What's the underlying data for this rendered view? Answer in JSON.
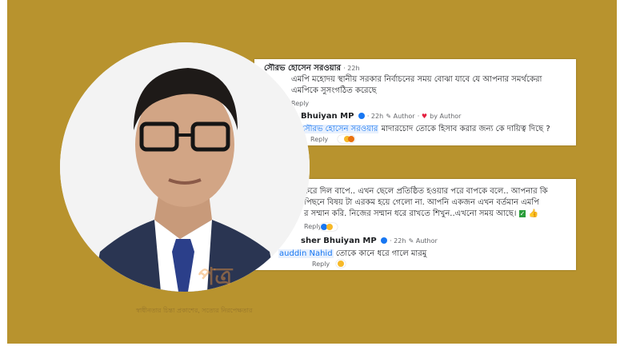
{
  "comments": {
    "c1": {
      "author": "সৌরভ হোসেন সরওয়ার",
      "time": "22h",
      "text_line1": "এমপি মহোদয় স্থানীয় সরকার নির্বাচনের সময় বোঝা যাবে যে আপনার সমর্থকেরা",
      "text_line2": "এমপিকে সুসংগঠিত করেছে",
      "reply_label": "Reply"
    },
    "r1": {
      "author": "Bhuiyan MP",
      "time": "22h",
      "author_tag": "Author",
      "liked_by": "Author",
      "mention": "সৌরভ হোসেন সরওয়ার",
      "text": "মাদারচোদ তোকে হিসাব করার জন্য কে দায়িত্ব দিছে ?",
      "reply_label": "Reply"
    },
    "c2": {
      "text_line1": "করে দিল বাপে.. এখন ছেলে প্রতিষ্ঠিত হওয়ার পরে বাপকে বলে.. আপনার কি",
      "text_line2": "পিছনে বিষয় টা এরকম হয়ে গেলো না. আপনি একজন এখন বর্তমান এমপি",
      "text_line3": "র সম্মান করি. নিজের সম্মান ধরে রাখতে শিখুন..এখনো সময় আছে।",
      "reply_label": "Reply"
    },
    "r2": {
      "author": "sher Bhuiyan MP",
      "time": "22h",
      "author_tag": "Author",
      "mention": "Nahid",
      "mention_prefix": "auddin",
      "text": "তোকে কানে ধরে গালে মারমু",
      "reply_label": "Reply"
    }
  },
  "watermark": {
    "logo_text": "পত্র",
    "tagline": "স্বাধীনতার চিন্তা প্রকাশের, সত্যের নিরপেক্ষতার"
  },
  "colors": {
    "background_gold": "#b8932e",
    "facebook_blue": "#1877f2"
  }
}
